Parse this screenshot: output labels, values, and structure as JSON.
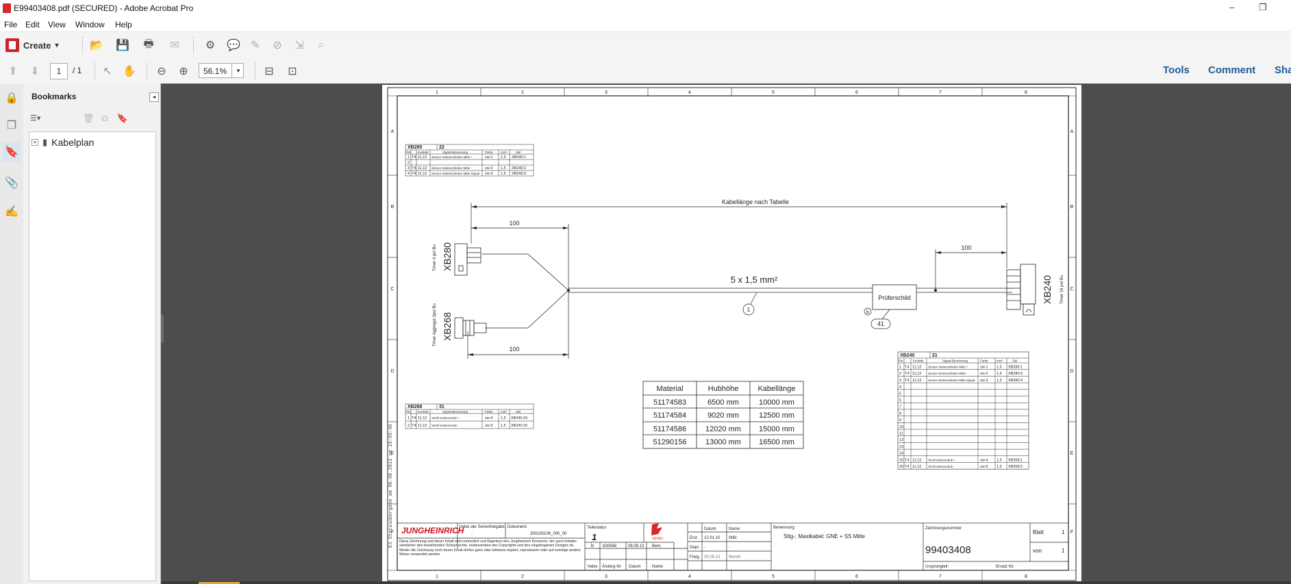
{
  "window": {
    "title": "E99403408.pdf (SECURED) - Adobe Acrobat Pro",
    "minimize": "–",
    "restore": "❐"
  },
  "menu": [
    "File",
    "Edit",
    "View",
    "Window",
    "Help"
  ],
  "toolbar": {
    "create_label": "Create",
    "create_arrow": "▾"
  },
  "nav": {
    "page_current": "1",
    "page_total": "/ 1",
    "zoom": "56.1%",
    "zoom_arrow": "▾"
  },
  "right_links": {
    "tools": "Tools",
    "comment": "Comment",
    "share": "Sha"
  },
  "bookmarks": {
    "title": "Bookmarks",
    "options_icon": "☰▾",
    "items": [
      {
        "label": "Kabelplan"
      }
    ]
  },
  "drawing": {
    "grid_cols": [
      "1",
      "2",
      "3",
      "4",
      "5",
      "6",
      "7",
      "8"
    ],
    "grid_rows": [
      "A",
      "B",
      "C",
      "D",
      "E",
      "F"
    ],
    "cable_length_label": "Kabellänge nach Tabelle",
    "dim_100": "100",
    "cable_spec": "5 x 1,5 mm²",
    "pruferschild": "Prüferschild",
    "callout_1": "1",
    "callout_41": "41",
    "callout_b": "b",
    "xb280": {
      "name": "XB280",
      "sub": "Timer 4 pol Bu"
    },
    "xb268": {
      "name": "XB268",
      "sub": "Timer Aggregat 2pol Bu"
    },
    "xb240": {
      "name": "XB240",
      "sub": "Timer 16 pol Bu"
    },
    "pin_headers": [
      "Pin",
      "Kontakt",
      "Signal-Benennung",
      "Farbe",
      "mm²",
      "Ziel"
    ],
    "table_xb280": {
      "title": "XB280",
      "count": "22",
      "rows": [
        [
          "1",
          "T4",
          "11,12",
          "Sensor Seitenschieber Mitte +",
          "sw-1",
          "1,5",
          "XB240:1"
        ],
        [
          "2",
          "",
          "",
          "",
          "",
          "",
          ""
        ],
        [
          "3",
          "T4",
          "11,12",
          "Sensor Seitenschieber Mitte -",
          "sw-2",
          "1,5",
          "XB240:2"
        ],
        [
          "4",
          "T4",
          "11,12",
          "Sensor Seitenschieber Mitte Signal",
          "sw-3",
          "1,5",
          "XB240:3"
        ]
      ]
    },
    "table_xb268": {
      "title": "XB268",
      "count": "31",
      "rows": [
        [
          "1",
          "T4",
          "11,12",
          "Ventil Seitenschub +",
          "sw-4",
          "1,5",
          "XB240:15"
        ],
        [
          "2",
          "T4",
          "11,12",
          "Ventil Seitenschub -",
          "sw-5",
          "1,5",
          "XB240:16"
        ]
      ]
    },
    "table_xb240": {
      "title": "XB240",
      "count": "21",
      "rows": [
        [
          "1",
          "T4",
          "11,12",
          "Sensor Seitenschieber Mitte +",
          "sw-1",
          "1,5",
          "XB280:1"
        ],
        [
          "2",
          "T4",
          "11,12",
          "Sensor Seitenschieber Mitte -",
          "sw-2",
          "1,5",
          "XB280:3"
        ],
        [
          "3",
          "T4",
          "11,12",
          "Sensor Seitenschieber Mitte Signal",
          "sw-3",
          "1,5",
          "XB280:4"
        ],
        [
          "4",
          "",
          "",
          "",
          "",
          "",
          ""
        ],
        [
          "5",
          "",
          "",
          "",
          "",
          "",
          ""
        ],
        [
          "6",
          "",
          "",
          "",
          "",
          "",
          ""
        ],
        [
          "7",
          "",
          "",
          "",
          "",
          "",
          ""
        ],
        [
          "8",
          "",
          "",
          "",
          "",
          "",
          ""
        ],
        [
          "9",
          "",
          "",
          "",
          "",
          "",
          ""
        ],
        [
          "10",
          "",
          "",
          "",
          "",
          "",
          ""
        ],
        [
          "11",
          "",
          "",
          "",
          "",
          "",
          ""
        ],
        [
          "12",
          "",
          "",
          "",
          "",
          "",
          ""
        ],
        [
          "13",
          "",
          "",
          "",
          "",
          "",
          ""
        ],
        [
          "14",
          "",
          "",
          "",
          "",
          "",
          ""
        ],
        [
          "15",
          "T4",
          "11,12",
          "Ventil Seitenschub +",
          "sw-4",
          "1,5",
          "XB268:1"
        ],
        [
          "16",
          "T4",
          "11,12",
          "Ventil Seitenschub -",
          "sw-5",
          "1,5",
          "XB268:2"
        ]
      ]
    },
    "material_table": {
      "headers": [
        "Material",
        "Hubhöhe",
        "Kabellänge"
      ],
      "rows": [
        [
          "51174583",
          "6500 mm",
          "10000 mm"
        ],
        [
          "51174584",
          "9020 mm",
          "12500 mm"
        ],
        [
          "51174586",
          "12020 mm",
          "15000 mm"
        ],
        [
          "51290156",
          "13000 mm",
          "16500 mm"
        ]
      ]
    },
    "side_note": "E3 Statusübergabe am 08.08.2013 um 10:50:48",
    "titleblock": {
      "brand": "JUNGHEINRICH",
      "copyright": "Diese Zeichnung und deren Inhalt sind vertraulich und Eigentum des Jungheinrich Konzerns, der auch Inhaber sämtlicher den bestehenden Schutzrechte. Insbesondere des Copyrights und des eingetragenen Designs ist. Weder die Zeichnung noch deren Inhalt dürfen ganz oder teilweise kopiert, reproduziert oder auf sonstige andere Weise verwendet werden.",
      "index_label": "Index der Serienfreigabe:",
      "index_value": "-",
      "dokument_label": "Dokument:",
      "dokument_value": "300193106_000_00",
      "teilestatus_label": "Teilestatus",
      "teilestatus_value": "1",
      "series_label": "series",
      "rev_b": "b",
      "rev_num": "630568",
      "rev_date": "08.08.13",
      "rev_bem": "Bem.",
      "col_index": "Index",
      "col_aender": "Änderg-Nr",
      "col_datum": "Datum",
      "col_name": "Name",
      "erst": "Erst.",
      "gepr": "Gepr.",
      "freig": "Freig.",
      "datum_h": "Datum",
      "name_h": "Name",
      "erst_date": "12.01.10",
      "erst_name": "Willr.",
      "gepr_date": "-",
      "gepr_name": "-",
      "freig_date": "08.08.13",
      "freig_name": "Bemitt",
      "benennung_label": "Benennung",
      "benennung_value": "Sttg-; Mastkabel; GNE + SS Mitte",
      "zeichnungsnummer_label": "Zeichnungsnummer",
      "zeichnungsnummer_value": "99403408",
      "blatt_label": "Blatt",
      "blatt_value": "1",
      "von_label": "von",
      "von_value": "1",
      "ursprung_label": "Ursprungteil:",
      "ersatz_label": "Ersatz für:"
    }
  }
}
